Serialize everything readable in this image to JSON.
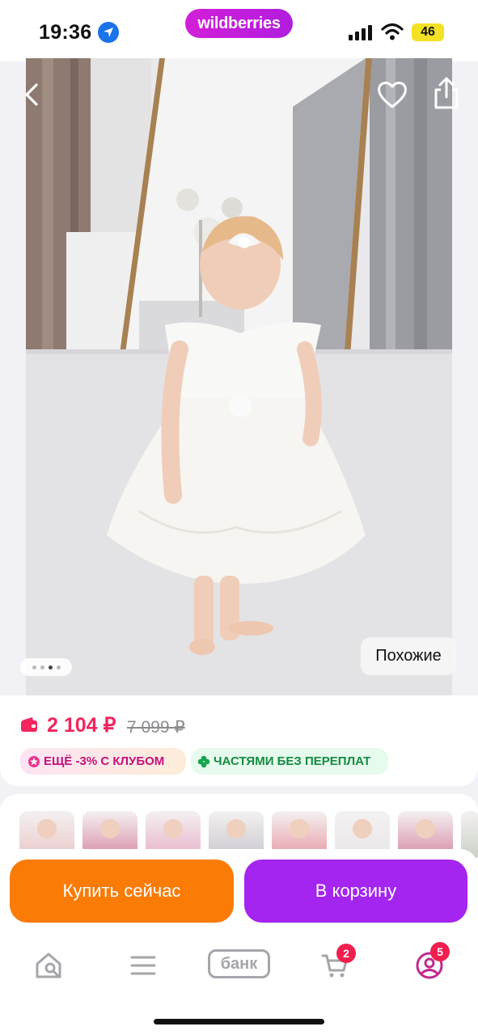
{
  "status_bar": {
    "time": "19:36",
    "brand": "wildberries",
    "battery": "46",
    "icons": [
      "location-arrow-icon",
      "cellular-signal-icon",
      "wifi-icon",
      "battery-icon"
    ],
    "battery_color": "#f3e125"
  },
  "photo": {
    "description_icons": [
      "back-chevron-icon",
      "heart-icon",
      "share-icon"
    ],
    "similar_label": "Похожие",
    "carousel": {
      "count": 4,
      "active_index": 2
    }
  },
  "product": {
    "price": "2 104 ₽",
    "old_price": "7 099 ₽",
    "price_color": "#f2255f",
    "badges": [
      {
        "label": "ЕЩЁ -3% С КЛУБОМ",
        "icon": "club-flower-icon",
        "color": "#c3117d"
      },
      {
        "label": "ЧАСТЯМИ БЕЗ ПЕРЕПЛАТ",
        "icon": "clover-icon",
        "color": "#138b3f"
      }
    ]
  },
  "thumbnails": {
    "count": 8,
    "palette": [
      "#e9c7c9",
      "#d88aa6",
      "#e7b0c9",
      "#c8c6cd",
      "#e79aa3",
      "#e8e6e8",
      "#d48aa4",
      "#c9d0c5"
    ]
  },
  "actions": {
    "buy_now": "Купить сейчас",
    "add_to_cart": "В корзину",
    "buy_color": "#fb7b07",
    "cart_color": "#a424f0"
  },
  "tabbar": {
    "items": [
      {
        "name": "home-search",
        "icon": "home-search-icon"
      },
      {
        "name": "catalog",
        "icon": "menu-lines-icon"
      },
      {
        "name": "bank",
        "label": "банк"
      },
      {
        "name": "cart",
        "icon": "cart-icon",
        "badge": "2"
      },
      {
        "name": "profile",
        "icon": "profile-icon",
        "badge": "5"
      }
    ]
  }
}
